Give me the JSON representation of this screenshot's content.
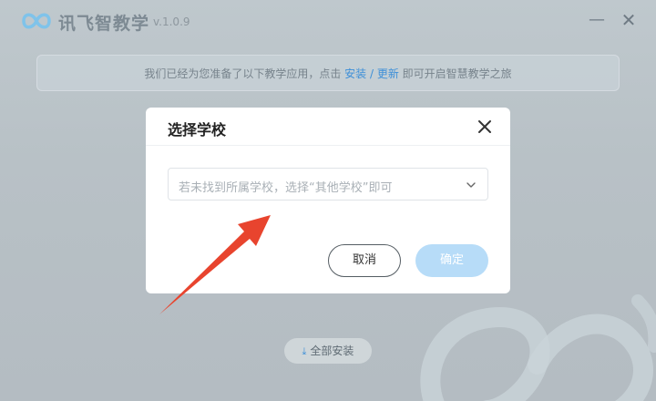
{
  "app": {
    "name": "讯飞智教学",
    "version": "v.1.0.9",
    "icons": {
      "logo": "infinity-logo-icon",
      "minimize": "minimize-icon",
      "close": "close-icon"
    }
  },
  "notice": {
    "prefix": "我们已经为您准备了以下教学应用，点击 ",
    "link_install": "安装",
    "separator": " / ",
    "link_update": "更新",
    "suffix": " 即可开启智慧教学之旅"
  },
  "install_all": {
    "label": "全部安装",
    "icon": "download-icon"
  },
  "dialog": {
    "title": "选择学校",
    "close_icon": "close-icon",
    "select": {
      "placeholder": "若未找到所属学校，选择“其他学校”即可",
      "icon": "chevron-down-icon"
    },
    "cancel_label": "取消",
    "ok_label": "确定"
  },
  "colors": {
    "accent": "#3d8fd8",
    "ok_button_disabled": "#b7dcf8",
    "annotation_arrow": "#e8442e"
  }
}
